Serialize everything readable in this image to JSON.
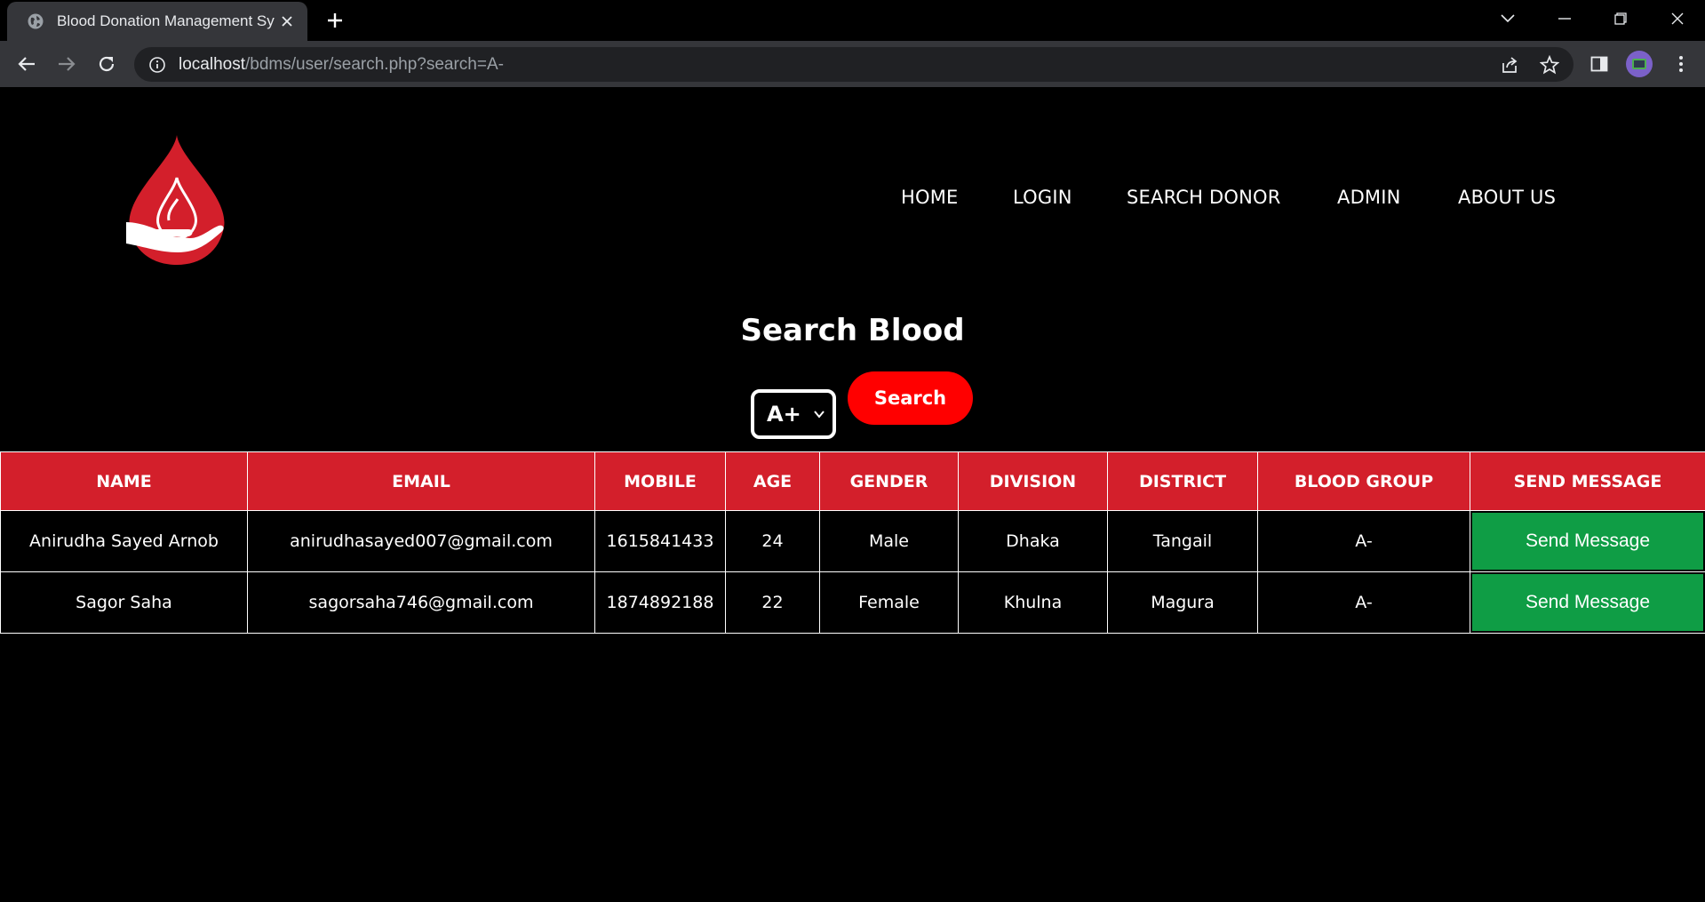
{
  "browser": {
    "tab_title": "Blood Donation Management Sy",
    "url_host": "localhost",
    "url_path": "/bdms/user/search.php?search=A-"
  },
  "nav": {
    "home": "HOME",
    "login": "LOGIN",
    "search_donor": "SEARCH DONOR",
    "admin": "ADMIN",
    "about_us": "ABOUT US"
  },
  "search": {
    "title": "Search Blood",
    "selected_group": "A+",
    "button": "Search"
  },
  "table": {
    "headers": [
      "NAME",
      "EMAIL",
      "MOBILE",
      "AGE",
      "GENDER",
      "DIVISION",
      "DISTRICT",
      "BLOOD GROUP",
      "SEND MESSAGE"
    ],
    "rows": [
      {
        "name": "Anirudha Sayed Arnob",
        "email": "anirudhasayed007@gmail.com",
        "mobile": "1615841433",
        "age": "24",
        "gender": "Male",
        "division": "Dhaka",
        "district": "Tangail",
        "blood_group": "A-",
        "action": "Send Message"
      },
      {
        "name": "Sagor Saha",
        "email": "sagorsaha746@gmail.com",
        "mobile": "1874892188",
        "age": "22",
        "gender": "Female",
        "division": "Khulna",
        "district": "Magura",
        "blood_group": "A-",
        "action": "Send Message"
      }
    ]
  },
  "colors": {
    "brand_red": "#d31f2b",
    "search_button": "#ff0000",
    "send_button": "#0f9d45"
  }
}
